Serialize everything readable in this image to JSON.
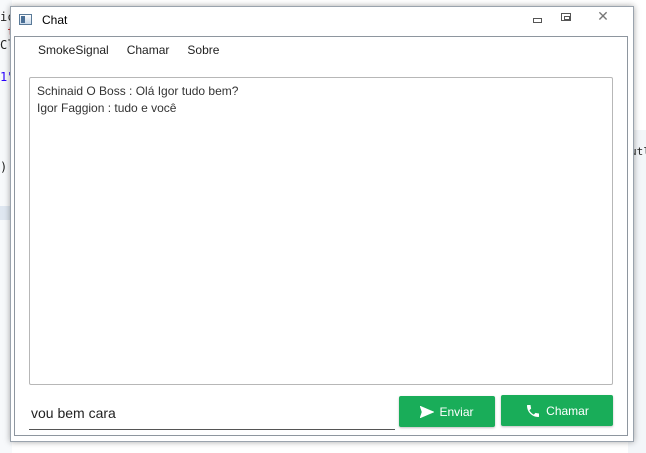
{
  "background": {
    "code_fragments": [
      "ic",
      " t",
      "Cl",
      "1\"",
      ")"
    ],
    "right_fragment": "utl"
  },
  "window": {
    "title": "Chat",
    "controls": {
      "minimize_icon": "minimize-icon",
      "maximize_icon": "maximize-icon",
      "close_icon": "close-icon"
    }
  },
  "menu": {
    "items": [
      "SmokeSignal",
      "Chamar",
      "Sobre"
    ]
  },
  "chat": {
    "messages": [
      "Schinaid O Boss : Olá Igor tudo bem?",
      "Igor Faggion : tudo e você"
    ]
  },
  "input": {
    "value": "vou bem cara"
  },
  "buttons": {
    "send_label": "Enviar",
    "send_icon": "send-icon",
    "call_label": "Chamar",
    "call_icon": "phone-icon"
  },
  "colors": {
    "button_green": "#19ad59",
    "button_text": "#ffffff"
  }
}
